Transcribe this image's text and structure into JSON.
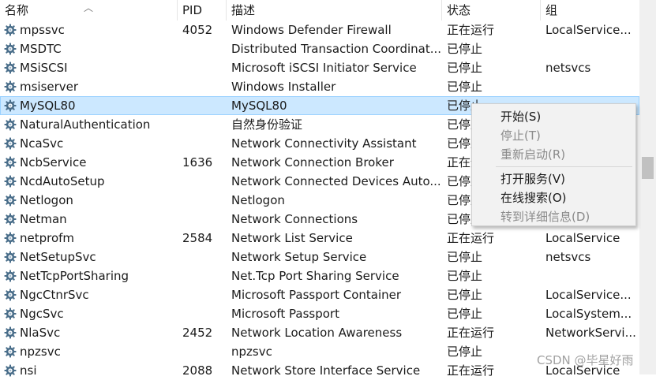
{
  "columns": [
    "名称",
    "PID",
    "描述",
    "状态",
    "组"
  ],
  "rows": [
    {
      "name": "mpssvc",
      "pid": "4052",
      "desc": "Windows Defender Firewall",
      "status": "正在运行",
      "group": "LocalService..."
    },
    {
      "name": "MSDTC",
      "pid": "",
      "desc": "Distributed Transaction Coordinat...",
      "status": "已停止",
      "group": ""
    },
    {
      "name": "MSiSCSI",
      "pid": "",
      "desc": "Microsoft iSCSI Initiator Service",
      "status": "已停止",
      "group": "netsvcs"
    },
    {
      "name": "msiserver",
      "pid": "",
      "desc": "Windows Installer",
      "status": "已停止",
      "group": ""
    },
    {
      "name": "MySQL80",
      "pid": "",
      "desc": "MySQL80",
      "status": "已停止",
      "group": ""
    },
    {
      "name": "NaturalAuthentication",
      "pid": "",
      "desc": "自然身份验证",
      "status": "已停止",
      "group": ""
    },
    {
      "name": "NcaSvc",
      "pid": "",
      "desc": "Network Connectivity Assistant",
      "status": "已停止",
      "group": ""
    },
    {
      "name": "NcbService",
      "pid": "1636",
      "desc": "Network Connection Broker",
      "status": "正在运行",
      "group": ""
    },
    {
      "name": "NcdAutoSetup",
      "pid": "",
      "desc": "Network Connected Devices Auto...",
      "status": "已停止",
      "group": ""
    },
    {
      "name": "Netlogon",
      "pid": "",
      "desc": "Netlogon",
      "status": "已停止",
      "group": ""
    },
    {
      "name": "Netman",
      "pid": "",
      "desc": "Network Connections",
      "status": "已停止",
      "group": ""
    },
    {
      "name": "netprofm",
      "pid": "2584",
      "desc": "Network List Service",
      "status": "正在运行",
      "group": "LocalService"
    },
    {
      "name": "NetSetupSvc",
      "pid": "",
      "desc": "Network Setup Service",
      "status": "已停止",
      "group": "netsvcs"
    },
    {
      "name": "NetTcpPortSharing",
      "pid": "",
      "desc": "Net.Tcp Port Sharing Service",
      "status": "已停止",
      "group": ""
    },
    {
      "name": "NgcCtnrSvc",
      "pid": "",
      "desc": "Microsoft Passport Container",
      "status": "已停止",
      "group": "LocalService..."
    },
    {
      "name": "NgcSvc",
      "pid": "",
      "desc": "Microsoft Passport",
      "status": "已停止",
      "group": "LocalSystem..."
    },
    {
      "name": "NlaSvc",
      "pid": "2452",
      "desc": "Network Location Awareness",
      "status": "正在运行",
      "group": "NetworkServi..."
    },
    {
      "name": "npzsvc",
      "pid": "",
      "desc": "npzsvc",
      "status": "已停止",
      "group": ""
    },
    {
      "name": "nsi",
      "pid": "2088",
      "desc": "Network Store Interface Service",
      "status": "正在运行",
      "group": "LocalService"
    }
  ],
  "selected_row_index": 4,
  "context_menu": {
    "start": "开始(S)",
    "stop": "停止(T)",
    "restart": "重新启动(R)",
    "open_services": "打开服务(V)",
    "search_online": "在线搜索(O)",
    "go_to_details": "转到详细信息(D)"
  },
  "watermark": "CSDN @毕星好雨",
  "colors": {
    "selected_bg": "#cce8ff",
    "menu_bg": "#f2f2f2",
    "gear": "#4a6e8a"
  },
  "icons": {
    "service": "gear-icon",
    "sort": "sort-up-icon"
  }
}
